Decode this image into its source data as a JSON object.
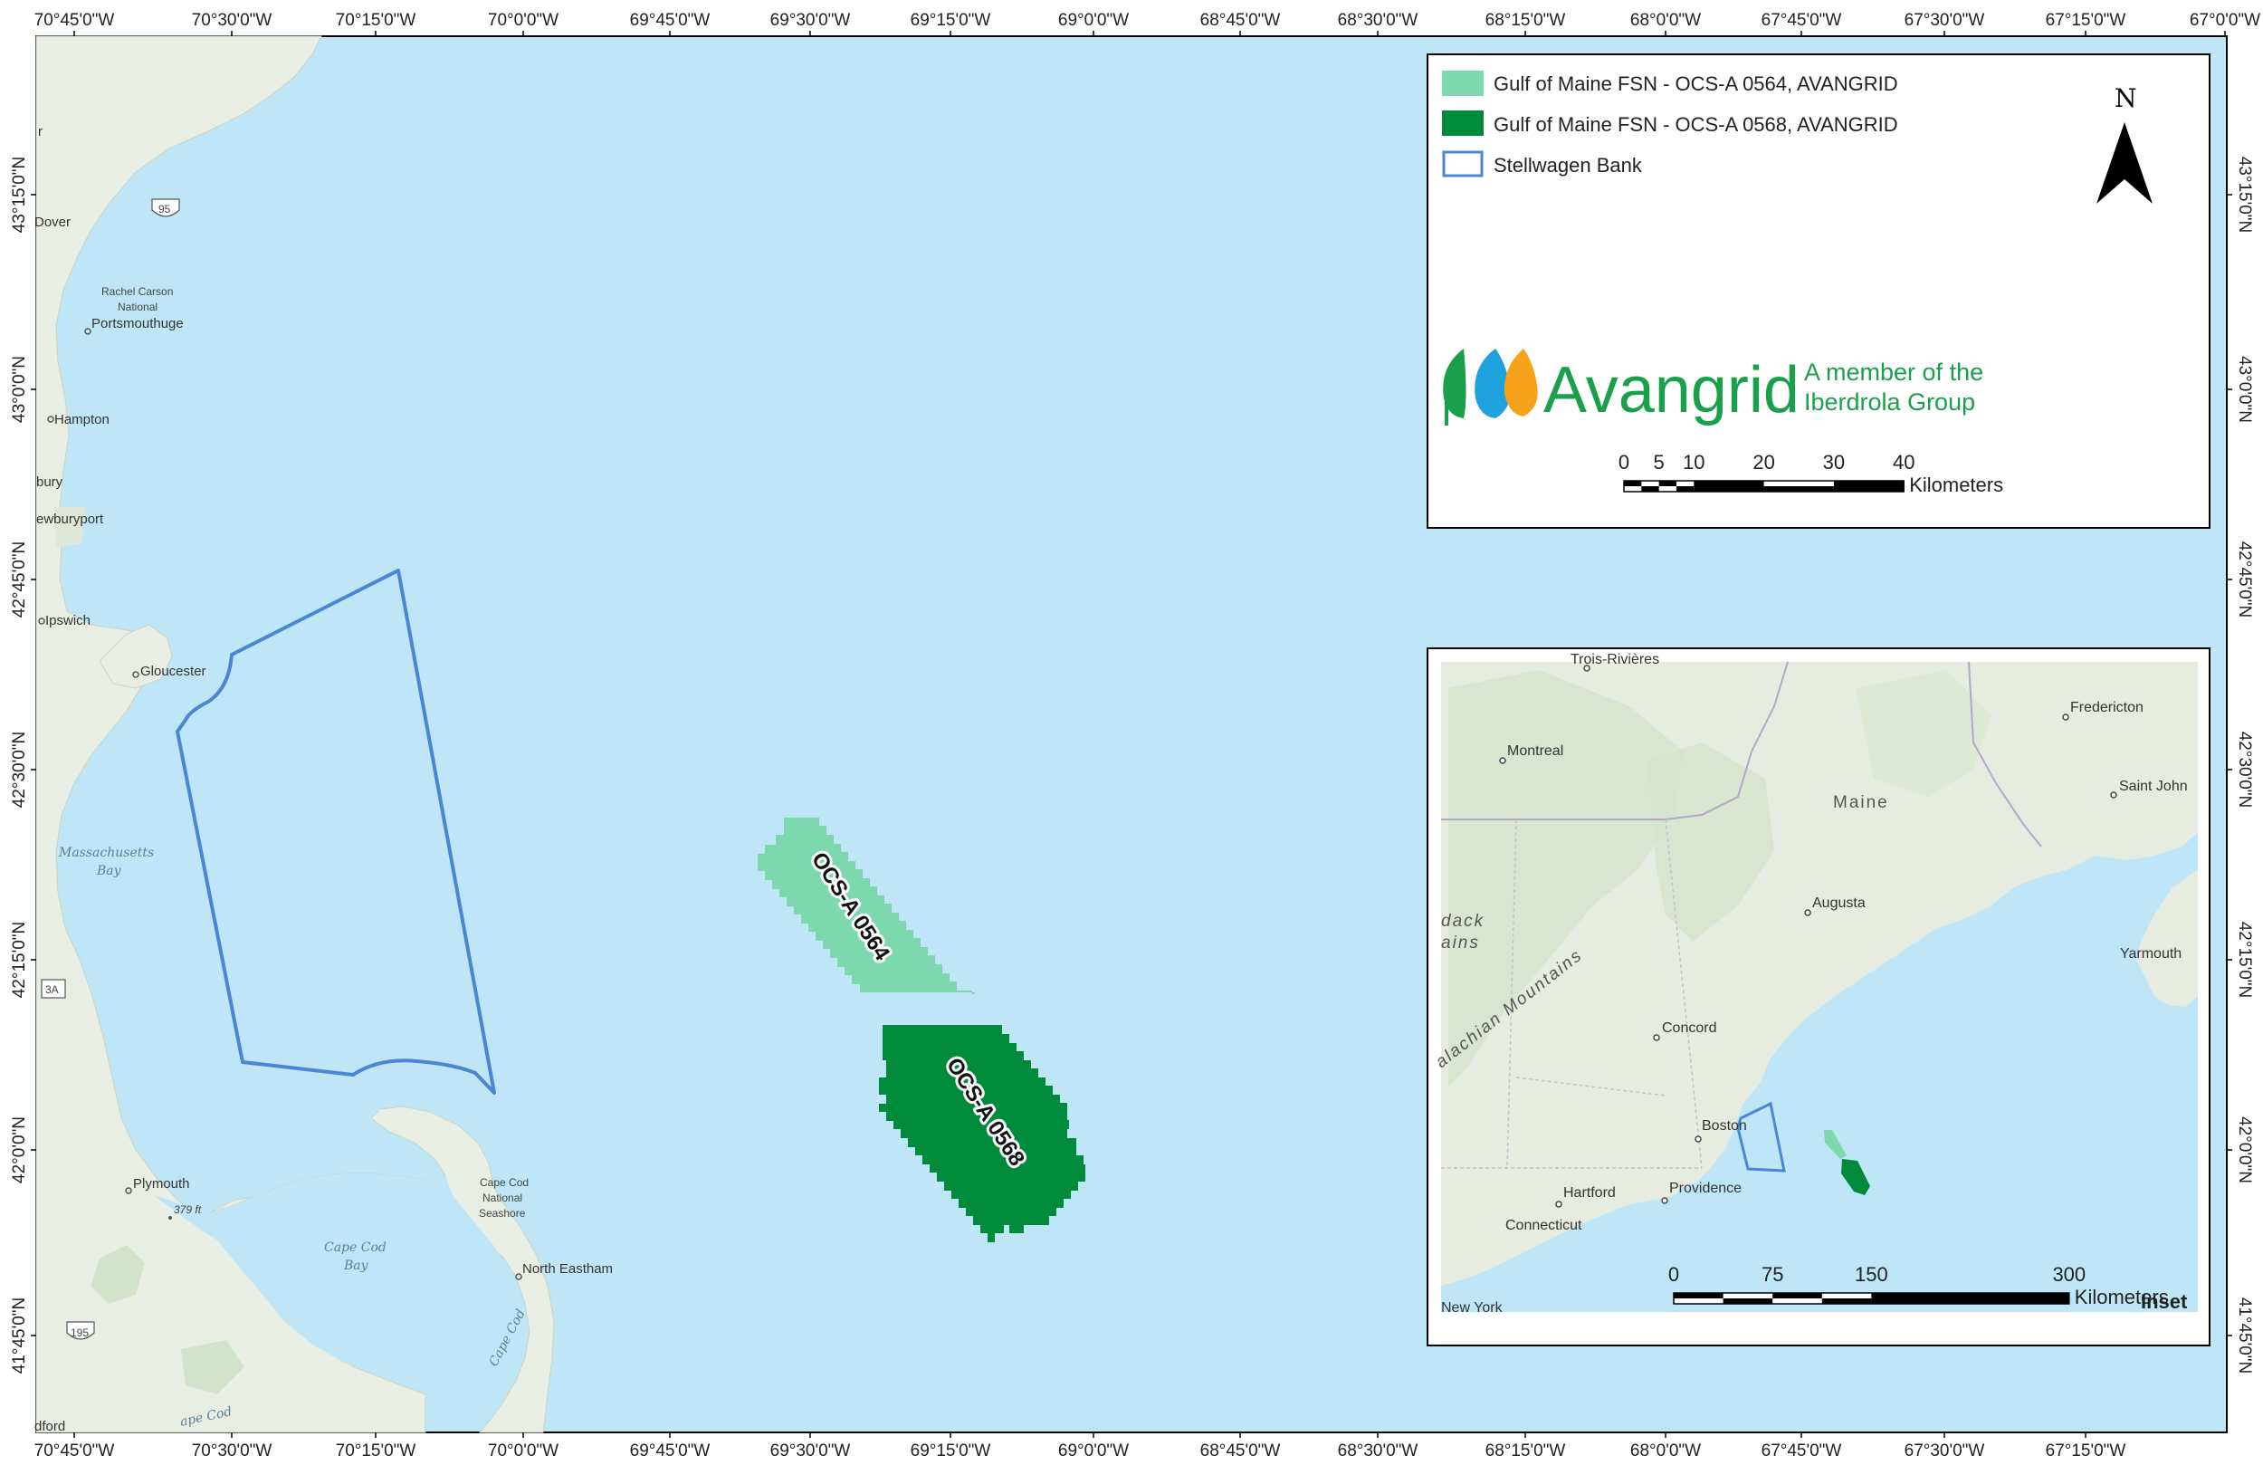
{
  "grid": {
    "top_labels": [
      "70°45'0\"W",
      "70°30'0\"W",
      "70°15'0\"W",
      "70°0'0\"W",
      "69°45'0\"W",
      "69°30'0\"W",
      "69°15'0\"W",
      "69°0'0\"W",
      "68°45'0\"W",
      "68°30'0\"W",
      "68°15'0\"W",
      "68°0'0\"W",
      "67°45'0\"W",
      "67°30'0\"W",
      "67°15'0\"W",
      "67°0'0\"W"
    ],
    "bottom_labels": [
      "70°45'0\"W",
      "70°30'0\"W",
      "70°15'0\"W",
      "70°0'0\"W",
      "69°45'0\"W",
      "69°30'0\"W",
      "69°15'0\"W",
      "69°0'0\"W",
      "68°45'0\"W",
      "68°30'0\"W",
      "68°15'0\"W",
      "68°0'0\"W",
      "67°45'0\"W",
      "67°30'0\"W",
      "67°15'0\"W"
    ],
    "left_labels": [
      "43°15'0\"N",
      "43°0'0\"N",
      "42°45'0\"N",
      "42°30'0\"N",
      "42°15'0\"N",
      "42°0'0\"N",
      "41°45'0\"N"
    ],
    "right_labels": [
      "43°15'0\"N",
      "43°0'0\"N",
      "42°45'0\"N",
      "42°30'0\"N",
      "42°15'0\"N",
      "42°0'0\"N",
      "41°45'0\"N"
    ]
  },
  "places": {
    "dover": "Dover",
    "rachel_carson_1": "Rachel Carson",
    "rachel_carson_2": "National",
    "portsmouth": "Portsmouthuge",
    "hampton": "Hampton",
    "bury": "bury",
    "newburyport": "ewburyport",
    "ipswich": "Ipswich",
    "gloucester": "Gloucester",
    "plymouth": "Plymouth",
    "elevation": "379 ft",
    "cape_cod_ns_1": "Cape Cod",
    "cape_cod_ns_2": "National",
    "cape_cod_ns_3": "Seashore",
    "north_eastham": "North Eastham",
    "ford": "dford",
    "mass_bay_1": "Massachusetts",
    "mass_bay_2": "Bay",
    "cape_cod_bay_1": "Cape Cod",
    "cape_cod_bay_2": "Bay",
    "cape_cod_italic": "Cape Cod",
    "cape_cod_italic_2": "ape Cod",
    "shield_95": "95",
    "shield_3a": "3A",
    "shield_195": "195",
    "partial_r": "r"
  },
  "leases": {
    "a0564": "OCS-A 0564",
    "a0568": "OCS-A 0568"
  },
  "legend": {
    "item1": "Gulf of Maine FSN - OCS-A 0564, AVANGRID",
    "item2": "Gulf of Maine FSN - OCS-A 0568, AVANGRID",
    "item3": "Stellwagen Bank",
    "north": "N"
  },
  "logo": {
    "word": "Avangrid",
    "tag_line1": "A member of the",
    "tag_line2": "Iberdrola Group"
  },
  "scale_main": {
    "ticks": [
      "0",
      "5",
      "10",
      "20",
      "30",
      "40"
    ],
    "unit": "Kilometers"
  },
  "inset": {
    "title": "Inset",
    "places": {
      "montreal": "Montreal",
      "fredericton": "Fredericton",
      "saint_john": "Saint John",
      "maine": "Maine",
      "augusta": "Augusta",
      "yarmouth": "Yarmouth",
      "concord": "Concord",
      "boston": "Boston",
      "hartford": "Hartford",
      "providence": "Providence",
      "connecticut": "Connecticut",
      "new_york": "New York",
      "adirondack_1": "dack",
      "adirondack_2": "ains",
      "appalachian": "alachian Mountains",
      "three_rivers": "Trois-Rivières"
    },
    "scale_ticks": [
      "0",
      "75",
      "150",
      "300"
    ],
    "scale_unit": "Kilometers"
  },
  "colors": {
    "water": "#bfe6f7",
    "land": "#e9eee4",
    "lease_light": "#7dd9ad",
    "lease_dark": "#008a3c",
    "stellwagen": "#4a86d4"
  }
}
